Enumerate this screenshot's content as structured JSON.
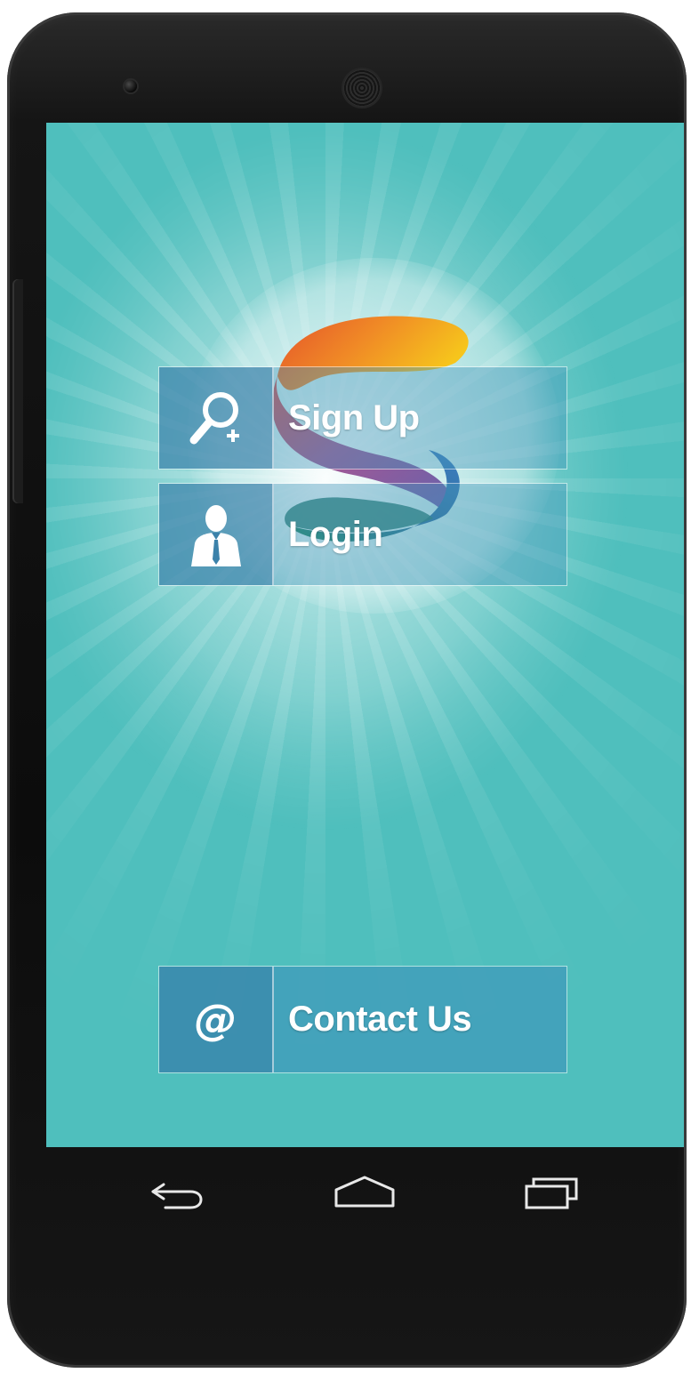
{
  "buttons": {
    "signup": {
      "label": "Sign Up",
      "icon": "search-add-icon"
    },
    "login": {
      "label": "Login",
      "icon": "user-icon"
    },
    "contact": {
      "label": "Contact Us",
      "icon": "at-icon",
      "glyph": "@"
    }
  },
  "navigation": {
    "items": [
      {
        "name": "back",
        "icon": "back-icon"
      },
      {
        "name": "home",
        "icon": "home-icon"
      },
      {
        "name": "recents",
        "icon": "recents-icon"
      }
    ]
  },
  "theme": {
    "screen_background": "#4fbfbd",
    "button_icon_cell": "#3c82aa",
    "phone_body": "#111111"
  }
}
